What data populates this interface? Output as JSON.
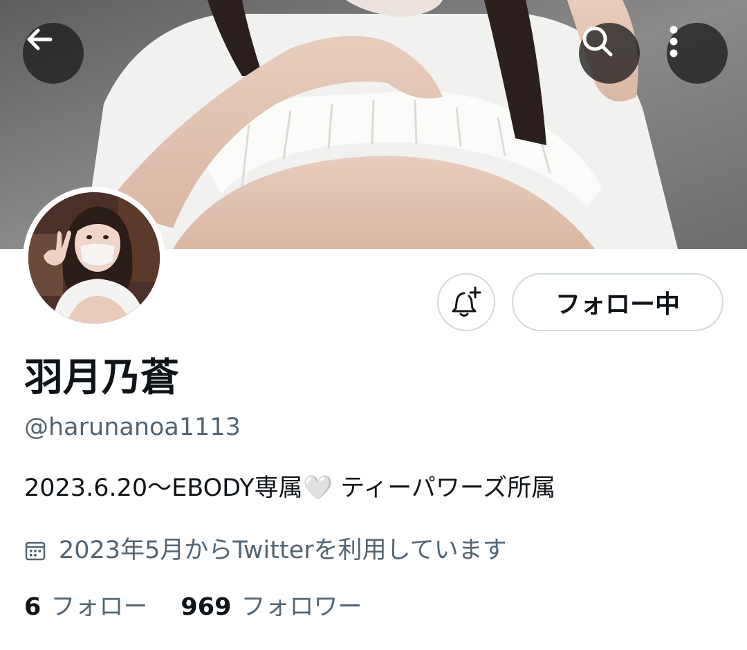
{
  "profile": {
    "display_name": "羽月乃蒼",
    "handle": "@harunanoa1113",
    "bio": "2023.6.20〜EBODY専属🤍 ティーパワーズ所属",
    "joined": "2023年5月からTwitterを利用しています"
  },
  "actions": {
    "follow_label": "フォロー中"
  },
  "stats": {
    "following_count": "6",
    "following_label": "フォロー",
    "followers_count": "969",
    "followers_label": "フォロワー"
  },
  "icons": {
    "back": "back-arrow-icon",
    "search": "search-icon",
    "more": "more-vertical-icon",
    "notify": "bell-plus-icon",
    "calendar": "calendar-icon"
  },
  "colors": {
    "text_primary": "#0f1419",
    "text_secondary": "#536471",
    "button_border": "#cfd9de",
    "overlay_button": "#1e1e1e"
  }
}
